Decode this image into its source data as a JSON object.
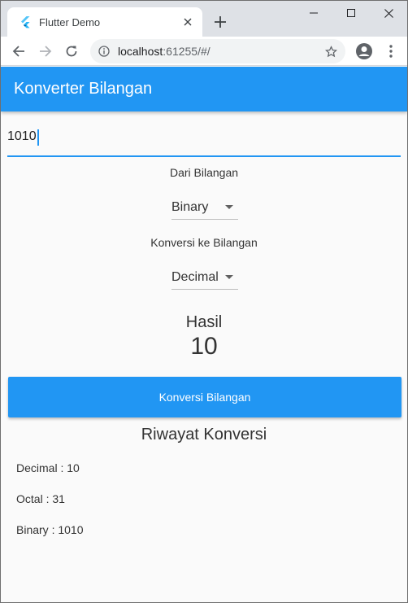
{
  "browser": {
    "tab_title": "Flutter Demo",
    "url_host": "localhost",
    "url_rest": ":61255/#/"
  },
  "app": {
    "title": "Konverter Bilangan",
    "input_value": "1010",
    "from_label": "Dari Bilangan",
    "from_selected": "Binary",
    "to_label": "Konversi ke Bilangan",
    "to_selected": "Decimal",
    "result_label": "Hasil",
    "result_value": "10",
    "convert_button": "Konversi Bilangan",
    "history_title": "Riwayat Konversi",
    "history": [
      "Decimal : 10",
      "Octal : 31",
      "Binary : 1010"
    ]
  },
  "colors": {
    "primary": "#2196f3",
    "tabstrip": "#dee1e6"
  }
}
